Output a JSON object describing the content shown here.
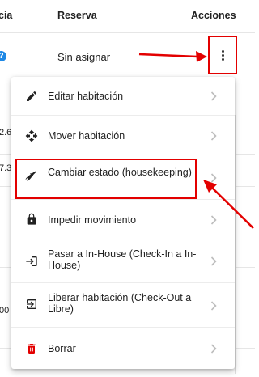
{
  "table": {
    "headers": {
      "col1": "cia",
      "reserva": "Reserva",
      "acciones": "Acciones"
    },
    "first_row": {
      "badge": "?",
      "reserva": "Sin asignar"
    },
    "partial_cells": [
      "2.6",
      "7.3",
      "00"
    ]
  },
  "menu": {
    "items": [
      {
        "icon": "pencil-icon",
        "label": "Editar habitación"
      },
      {
        "icon": "move-icon",
        "label": "Mover habitación"
      },
      {
        "icon": "broom-icon",
        "label": "Cambiar estado (housekeeping)"
      },
      {
        "icon": "lock-icon",
        "label": "Impedir movimiento"
      },
      {
        "icon": "check-in-icon",
        "label": "Pasar a In-House (Check-In a In-House)"
      },
      {
        "icon": "check-out-icon",
        "label": "Liberar habitación (Check-Out a Libre)"
      },
      {
        "icon": "trash-icon",
        "label": "Borrar"
      }
    ]
  },
  "colors": {
    "annotation": "#e30000",
    "badge": "#1e88e5",
    "delete": "#e30000"
  }
}
